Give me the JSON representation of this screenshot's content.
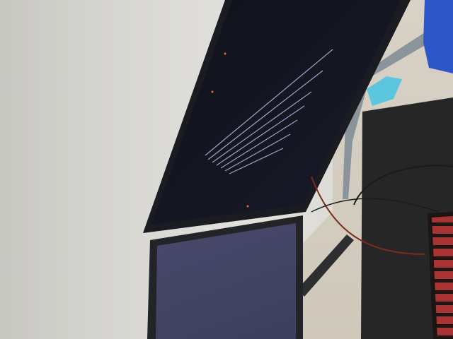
{
  "scene": {
    "type": "photo",
    "description_visible": ""
  },
  "colors": {
    "wall": "#d9d8d3",
    "desk": "#cfc8bb",
    "monitor_bezel": "#1a1c22",
    "controller": "#2d57c8",
    "keyboard_backlight": "#c23a3a",
    "stand": "#8c949b"
  }
}
